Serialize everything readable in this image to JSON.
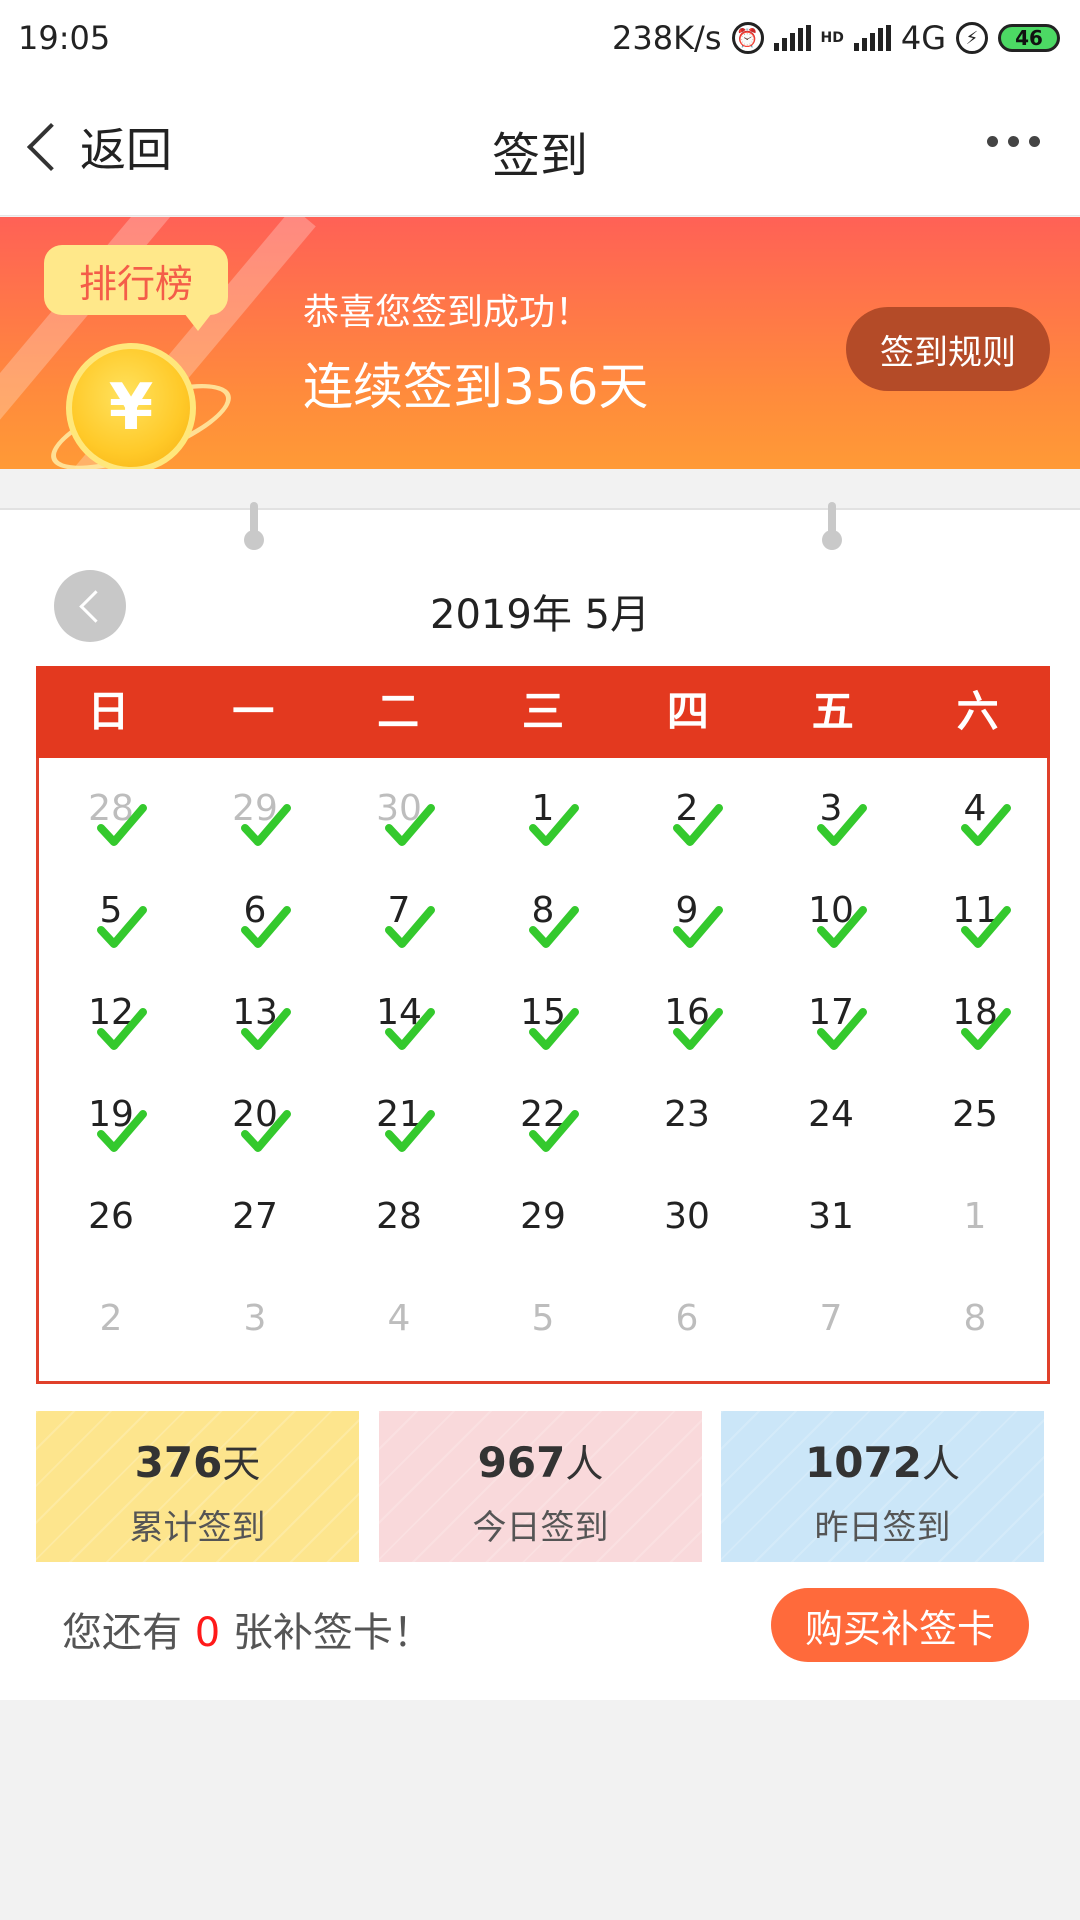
{
  "status_bar": {
    "time": "19:05",
    "net_speed": "238K/s",
    "network": "4G",
    "hd": "HD",
    "battery": "46"
  },
  "nav": {
    "back_label": "返回",
    "title": "签到"
  },
  "banner": {
    "rank_label": "排行榜",
    "coin_symbol": "¥",
    "line1": "恭喜您签到成功！",
    "line2": "连续签到356天",
    "rules_button": "签到规则"
  },
  "calendar": {
    "month_title": "2019年 5月",
    "weekdays": [
      "日",
      "一",
      "二",
      "三",
      "四",
      "五",
      "六"
    ],
    "check_color": "#34c92d",
    "days": [
      {
        "n": "28",
        "other": true,
        "checked": true
      },
      {
        "n": "29",
        "other": true,
        "checked": true
      },
      {
        "n": "30",
        "other": true,
        "checked": true
      },
      {
        "n": "1",
        "checked": true
      },
      {
        "n": "2",
        "checked": true
      },
      {
        "n": "3",
        "checked": true
      },
      {
        "n": "4",
        "checked": true
      },
      {
        "n": "5",
        "checked": true
      },
      {
        "n": "6",
        "checked": true
      },
      {
        "n": "7",
        "checked": true
      },
      {
        "n": "8",
        "checked": true
      },
      {
        "n": "9",
        "checked": true
      },
      {
        "n": "10",
        "checked": true
      },
      {
        "n": "11",
        "checked": true
      },
      {
        "n": "12",
        "checked": true
      },
      {
        "n": "13",
        "checked": true
      },
      {
        "n": "14",
        "checked": true
      },
      {
        "n": "15",
        "checked": true
      },
      {
        "n": "16",
        "checked": true
      },
      {
        "n": "17",
        "checked": true
      },
      {
        "n": "18",
        "checked": true
      },
      {
        "n": "19",
        "checked": true
      },
      {
        "n": "20",
        "checked": true
      },
      {
        "n": "21",
        "checked": true
      },
      {
        "n": "22",
        "checked": true
      },
      {
        "n": "23"
      },
      {
        "n": "24"
      },
      {
        "n": "25"
      },
      {
        "n": "26"
      },
      {
        "n": "27"
      },
      {
        "n": "28"
      },
      {
        "n": "29"
      },
      {
        "n": "30"
      },
      {
        "n": "31"
      },
      {
        "n": "1",
        "other": true
      },
      {
        "n": "2",
        "other": true
      },
      {
        "n": "3",
        "other": true
      },
      {
        "n": "4",
        "other": true
      },
      {
        "n": "5",
        "other": true
      },
      {
        "n": "6",
        "other": true
      },
      {
        "n": "7",
        "other": true
      },
      {
        "n": "8",
        "other": true
      }
    ]
  },
  "stats": [
    {
      "value": "376",
      "unit": "天",
      "label": "累计签到",
      "color": "#fde58d"
    },
    {
      "value": "967",
      "unit": "人",
      "label": "今日签到",
      "color": "#f9d9db"
    },
    {
      "value": "1072",
      "unit": "人",
      "label": "昨日签到",
      "color": "#cbe6f8"
    }
  ],
  "makeup": {
    "prefix": "您还有",
    "count": "0",
    "suffix": "张补签卡！",
    "buy_button": "购买补签卡"
  }
}
